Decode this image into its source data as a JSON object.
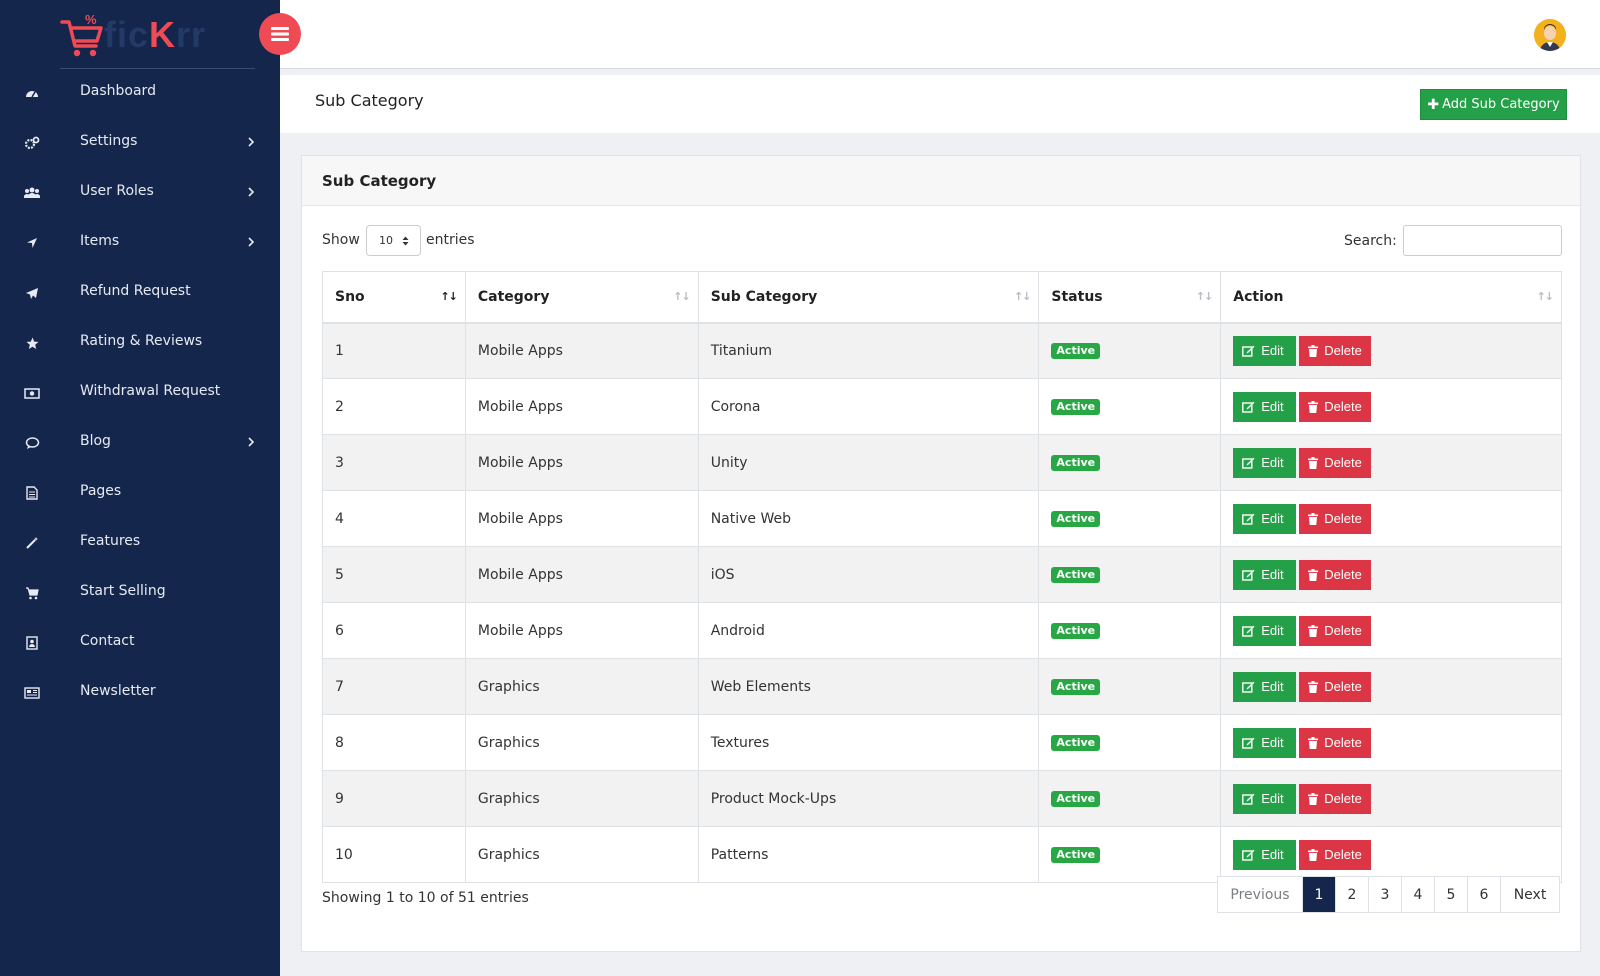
{
  "app": {
    "logo": {
      "part1": "fic",
      "part2": "K",
      "part3": "rr"
    },
    "colors": {
      "sidebar": "#14264b",
      "accent": "#ef4b55",
      "success": "#24a148",
      "danger": "#dc3545"
    }
  },
  "sidebar": {
    "items": [
      {
        "label": "Dashboard",
        "icon": "dashboard-icon",
        "has_children": false
      },
      {
        "label": "Settings",
        "icon": "gears-icon",
        "has_children": true
      },
      {
        "label": "User Roles",
        "icon": "users-icon",
        "has_children": true
      },
      {
        "label": "Items",
        "icon": "location-arrow-icon",
        "has_children": true
      },
      {
        "label": "Refund Request",
        "icon": "paper-plane-icon",
        "has_children": false
      },
      {
        "label": "Rating & Reviews",
        "icon": "star-icon",
        "has_children": false
      },
      {
        "label": "Withdrawal Request",
        "icon": "money-icon",
        "has_children": false
      },
      {
        "label": "Blog",
        "icon": "comment-icon",
        "has_children": true
      },
      {
        "label": "Pages",
        "icon": "file-icon",
        "has_children": false
      },
      {
        "label": "Features",
        "icon": "magic-wand-icon",
        "has_children": false
      },
      {
        "label": "Start Selling",
        "icon": "cart-icon",
        "has_children": false
      },
      {
        "label": "Contact",
        "icon": "contact-icon",
        "has_children": false
      },
      {
        "label": "Newsletter",
        "icon": "newspaper-icon",
        "has_children": false
      }
    ]
  },
  "header": {
    "page_title": "Sub Category",
    "add_button": "Add Sub Category"
  },
  "card": {
    "title": "Sub Category",
    "show_label": "Show",
    "page_size": "10",
    "entries_label": "entries",
    "search_label": "Search:"
  },
  "table": {
    "columns": [
      "Sno",
      "Category",
      "Sub Category",
      "Status",
      "Action"
    ],
    "rows": [
      {
        "sno": "1",
        "category": "Mobile Apps",
        "sub": "Titanium",
        "status": "Active"
      },
      {
        "sno": "2",
        "category": "Mobile Apps",
        "sub": "Corona",
        "status": "Active"
      },
      {
        "sno": "3",
        "category": "Mobile Apps",
        "sub": "Unity",
        "status": "Active"
      },
      {
        "sno": "4",
        "category": "Mobile Apps",
        "sub": "Native Web",
        "status": "Active"
      },
      {
        "sno": "5",
        "category": "Mobile Apps",
        "sub": "iOS",
        "status": "Active"
      },
      {
        "sno": "6",
        "category": "Mobile Apps",
        "sub": "Android",
        "status": "Active"
      },
      {
        "sno": "7",
        "category": "Graphics",
        "sub": "Web Elements",
        "status": "Active"
      },
      {
        "sno": "8",
        "category": "Graphics",
        "sub": "Textures",
        "status": "Active"
      },
      {
        "sno": "9",
        "category": "Graphics",
        "sub": "Product Mock-Ups",
        "status": "Active"
      },
      {
        "sno": "10",
        "category": "Graphics",
        "sub": "Patterns",
        "status": "Active"
      }
    ],
    "edit_label": "Edit",
    "delete_label": "Delete"
  },
  "footer": {
    "showing": "Showing 1 to 10 of 51 entries",
    "prev": "Previous",
    "next": "Next",
    "pages": [
      "1",
      "2",
      "3",
      "4",
      "5",
      "6"
    ],
    "current_page": "1"
  }
}
